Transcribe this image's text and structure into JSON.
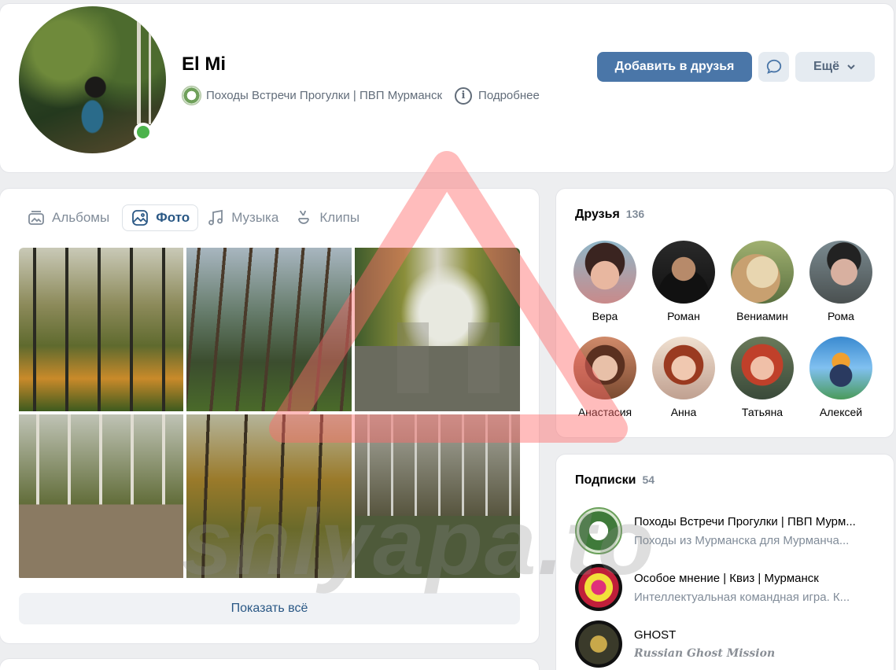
{
  "profile": {
    "name": "El Mi",
    "community": "Походы Встречи Прогулки | ПВП Мурманск",
    "details_label": "Подробнее",
    "online": true
  },
  "actions": {
    "add_friend": "Добавить в друзья",
    "more": "Ещё"
  },
  "media_tabs": [
    {
      "label": "Альбомы",
      "icon": "albums-icon",
      "active": false
    },
    {
      "label": "Фото",
      "icon": "photo-icon",
      "active": true
    },
    {
      "label": "Музыка",
      "icon": "music-icon",
      "active": false
    },
    {
      "label": "Клипы",
      "icon": "clips-icon",
      "active": false
    }
  ],
  "photos": {
    "show_all": "Показать всё"
  },
  "friends": {
    "title": "Друзья",
    "count": "136",
    "items": [
      {
        "name": "Вера"
      },
      {
        "name": "Роман"
      },
      {
        "name": "Вениамин"
      },
      {
        "name": "Рома"
      },
      {
        "name": "Анастасия"
      },
      {
        "name": "Анна"
      },
      {
        "name": "Татьяна"
      },
      {
        "name": "Алексей"
      }
    ]
  },
  "subscriptions": {
    "title": "Подписки",
    "count": "54",
    "items": [
      {
        "name": "Походы Встречи Прогулки | ПВП Мурм...",
        "desc": "Походы из Мурманска для Мурманча..."
      },
      {
        "name": "Особое мнение | Квиз | Мурманск",
        "desc": "Интеллектуальная командная игра. К..."
      },
      {
        "name": "GHOST",
        "desc": "Russian Ghost Mission"
      }
    ]
  },
  "watermark": {
    "text": "shlyapa.to",
    "color": "#ff6b6b"
  }
}
